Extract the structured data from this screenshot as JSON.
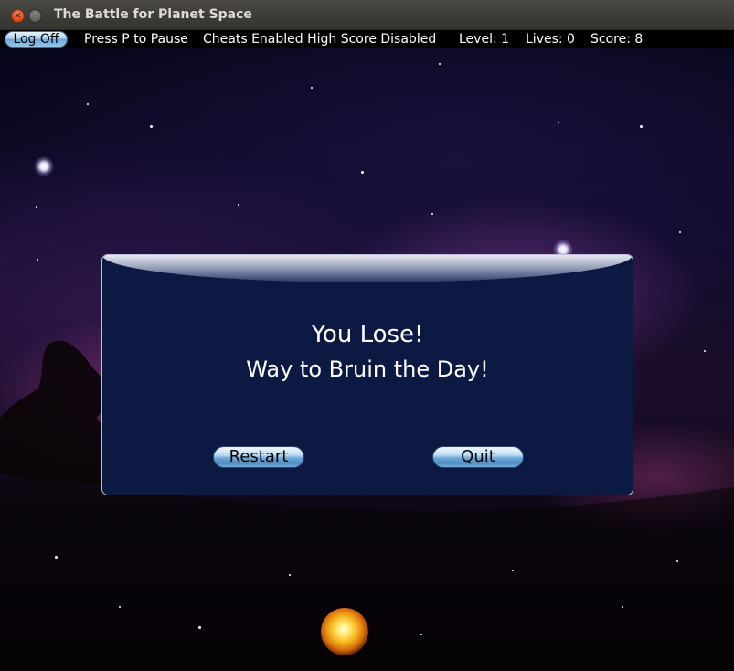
{
  "window": {
    "title": "The Battle for Planet Space",
    "close_glyph": "×",
    "minimize_glyph": "–"
  },
  "hud": {
    "logoff_label": "Log Off",
    "pause_hint": "Press P to Pause",
    "cheats_status": "Cheats Enabled High Score Disabled",
    "level_text": "Level: 1",
    "lives_text": "Lives:  0",
    "score_text": "Score:  8"
  },
  "game_over_dialog": {
    "title": "You Lose!",
    "message": "Way to Bruin the Day!",
    "restart_label": "Restart",
    "quit_label": "Quit"
  },
  "colors": {
    "dialog_background": "#0c1a43",
    "button_blue": "#6ea9d8",
    "hud_background": "#000000"
  },
  "icons": {
    "close": "close-icon",
    "minimize": "minimize-icon",
    "player_ship": "fireball-explosion-icon"
  }
}
